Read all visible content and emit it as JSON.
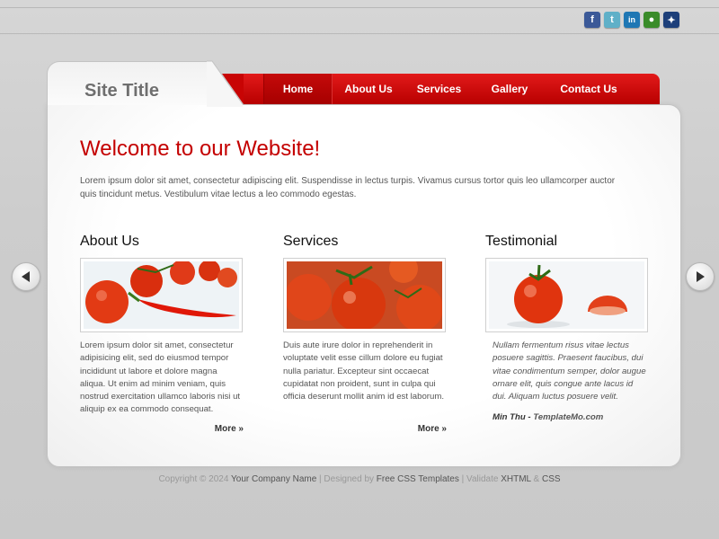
{
  "social": [
    {
      "icon": "facebook-icon",
      "glyph": "f",
      "color": "#3b5998"
    },
    {
      "icon": "twitter-icon",
      "glyph": "t",
      "color": "#5fb0c8"
    },
    {
      "icon": "linkedin-icon",
      "glyph": "in",
      "color": "#1f77b4"
    },
    {
      "icon": "chat-icon",
      "glyph": "●",
      "color": "#3a8c2a"
    },
    {
      "icon": "myspace-icon",
      "glyph": "✦",
      "color": "#1d3f7a"
    }
  ],
  "site_title": "Site Title",
  "nav": [
    {
      "label": "Home",
      "active": true
    },
    {
      "label": "About Us",
      "active": false
    },
    {
      "label": "Services",
      "active": false
    },
    {
      "label": "Gallery",
      "active": false
    },
    {
      "label": "Contact Us",
      "active": false
    }
  ],
  "main": {
    "heading": "Welcome to our Website!",
    "intro": "Lorem ipsum dolor sit amet, consectetur adipiscing elit. Suspendisse in lectus turpis. Vivamus cursus tortor quis leo ullamcorper auctor quis tincidunt metus. Vestibulum vitae lectus a leo commodo egestas."
  },
  "columns": {
    "about": {
      "title": "About Us",
      "text": "Lorem ipsum dolor sit amet, consectetur adipisicing elit, sed do eiusmod tempor incididunt ut labore et dolore magna aliqua. Ut enim ad minim veniam, quis nostrud exercitation ullamco laboris nisi ut aliquip ex ea commodo consequat.",
      "more": "More »"
    },
    "services": {
      "title": "Services",
      "text": "Duis aute irure dolor in reprehenderit in voluptate velit esse cillum dolore eu fugiat nulla pariatur. Excepteur sint occaecat cupidatat non proident, sunt in culpa qui officia deserunt mollit anim id est laborum.",
      "more": "More »"
    },
    "testimonial": {
      "title": "Testimonial",
      "text": "Nullam fermentum risus vitae lectus posuere sagittis. Praesent faucibus, dui vitae condimentum semper, dolor augue ornare elit, quis congue ante lacus id dui. Aliquam luctus posuere velit.",
      "author": "Min Thu",
      "separator": " - ",
      "author_site": "TemplateMo.com"
    }
  },
  "slider": {
    "prev_icon": "arrow-left-icon",
    "next_icon": "arrow-right-icon"
  },
  "footer": {
    "copyright": "Copyright © 2024 ",
    "company": "Your Company Name",
    "designed_by": " | Designed by ",
    "designer": "Free CSS Templates",
    "validate": " | Validate ",
    "xhtml": "XHTML",
    "amp": " & ",
    "css": "CSS"
  },
  "colors": {
    "accent": "#c40000",
    "nav": "#d40d0d"
  }
}
